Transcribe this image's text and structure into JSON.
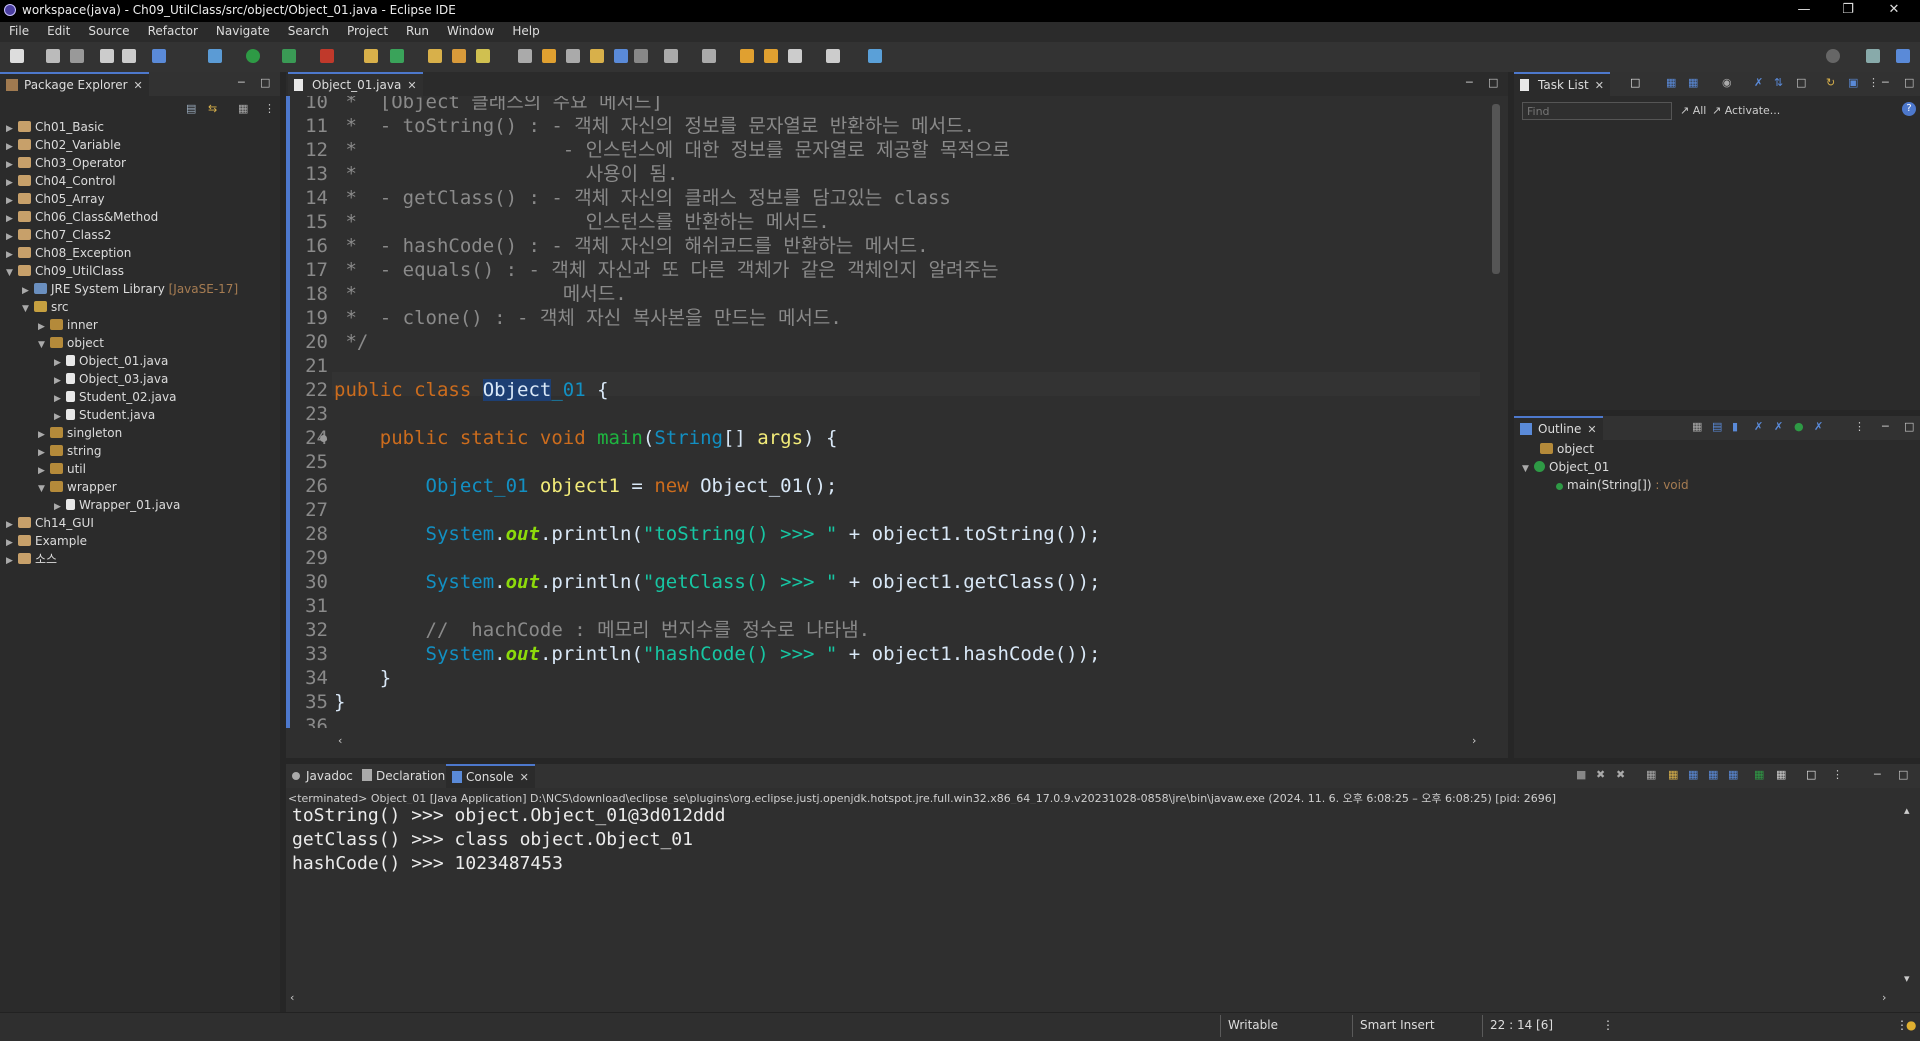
{
  "window": {
    "title": "workspace(java) - Ch09_UtilClass/src/object/Object_01.java - Eclipse IDE"
  },
  "menu": [
    "File",
    "Edit",
    "Source",
    "Refactor",
    "Navigate",
    "Search",
    "Project",
    "Run",
    "Window",
    "Help"
  ],
  "package_explorer": {
    "tab_label": "Package Explorer",
    "items": [
      {
        "label": "Ch01_Basic"
      },
      {
        "label": "Ch02_Variable"
      },
      {
        "label": "Ch03_Operator"
      },
      {
        "label": "Ch04_Control"
      },
      {
        "label": "Ch05_Array"
      },
      {
        "label": "Ch06_Class&Method"
      },
      {
        "label": "Ch07_Class2"
      },
      {
        "label": "Ch08_Exception"
      },
      {
        "label": "Ch09_UtilClass"
      },
      {
        "label": "JRE System Library",
        "deco": "[JavaSE-17]"
      },
      {
        "label": "src"
      },
      {
        "label": "inner"
      },
      {
        "label": "object"
      },
      {
        "label": "Object_01.java"
      },
      {
        "label": "Object_03.java"
      },
      {
        "label": "Student_02.java"
      },
      {
        "label": "Student.java"
      },
      {
        "label": "singleton"
      },
      {
        "label": "string"
      },
      {
        "label": "util"
      },
      {
        "label": "wrapper"
      },
      {
        "label": "Wrapper_01.java"
      },
      {
        "label": "Ch14_GUI"
      },
      {
        "label": "Example"
      },
      {
        "label": "소스"
      }
    ]
  },
  "editor": {
    "tab_label": "Object_01.java",
    "lines": [
      {
        "n": "10",
        "html": "<span class='cm'> *  [Object 클래스의 주요 메서드]</span>"
      },
      {
        "n": "11",
        "html": "<span class='cm'> *  - toString() : - 객체 자신의 정보를 문자열로 반환하는 메서드.</span>"
      },
      {
        "n": "12",
        "html": "<span class='cm'> *                  - 인스턴스에 대한 정보를 문자열로 제공할 목적으로</span>"
      },
      {
        "n": "13",
        "html": "<span class='cm'> *                    사용이 됨.</span>"
      },
      {
        "n": "14",
        "html": "<span class='cm'> *  - getClass() : - 객체 자신의 클래스 정보를 담고있는 class</span>"
      },
      {
        "n": "15",
        "html": "<span class='cm'> *                    인스턴스를 반환하는 메서드.</span>"
      },
      {
        "n": "16",
        "html": "<span class='cm'> *  - hashCode() : - 객체 자신의 해쉬코드를 반환하는 메서드.</span>"
      },
      {
        "n": "17",
        "html": "<span class='cm'> *  - equals() : - 객체 자신과 또 다른 객체가 같은 객체인지 알려주는</span>"
      },
      {
        "n": "18",
        "html": "<span class='cm'> *                  메서드.</span>"
      },
      {
        "n": "19",
        "html": "<span class='cm'> *  - clone() : - 객체 자신 복사본을 만드는 메서드.</span>"
      },
      {
        "n": "20",
        "html": "<span class='cm'> */</span>"
      },
      {
        "n": "21",
        "html": ""
      },
      {
        "n": "22",
        "html": "<span class='kw'>public class </span><span class='sel def'>Object</span><span class='ty'>_01</span><span class='def'> {</span>"
      },
      {
        "n": "23",
        "html": ""
      },
      {
        "n": "24",
        "html": "<span class='kw'>    public static void </span><span class='fn'>main</span><span class='def'>(</span><span class='ty'>String</span><span class='def'>[] </span><span class='var'>args</span><span class='def'>) {</span>"
      },
      {
        "n": "25",
        "html": ""
      },
      {
        "n": "26",
        "html": "<span class='ty'>        Object_01 </span><span class='var'>object1</span><span class='def'> = </span><span class='kw'>new </span><span class='def'>Object_01();</span>"
      },
      {
        "n": "27",
        "html": ""
      },
      {
        "n": "28",
        "html": "<span class='ty'>        System</span><span class='def'>.</span><span class='fld'>out</span><span class='def'>.println(</span><span class='st'>\"toString() &gt;&gt;&gt; \"</span><span class='def'> + object1.toString());</span>"
      },
      {
        "n": "29",
        "html": ""
      },
      {
        "n": "30",
        "html": "<span class='ty'>        System</span><span class='def'>.</span><span class='fld'>out</span><span class='def'>.println(</span><span class='st'>\"getClass() &gt;&gt;&gt; \"</span><span class='def'> + object1.getClass());</span>"
      },
      {
        "n": "31",
        "html": ""
      },
      {
        "n": "32",
        "html": "<span class='cm'>        //  hachCode : 메모리 번지수를 정수로 나타냄.</span>"
      },
      {
        "n": "33",
        "html": "<span class='ty'>        System</span><span class='def'>.</span><span class='fld'>out</span><span class='def'>.println(</span><span class='st'>\"hashCode() &gt;&gt;&gt; \"</span><span class='def'> + object1.hashCode());</span>"
      },
      {
        "n": "34",
        "html": "<span class='def'>    }</span>"
      },
      {
        "n": "35",
        "html": "<span class='def'>}</span>"
      },
      {
        "n": "36",
        "html": ""
      }
    ]
  },
  "task_list": {
    "tab_label": "Task List",
    "find_placeholder": "Find",
    "all_label": "All",
    "activate_label": "Activate..."
  },
  "outline": {
    "tab_label": "Outline",
    "package": "object",
    "class": "Object_01",
    "method": "main(String[])",
    "method_type": " : void"
  },
  "bottom_tabs": {
    "javadoc": "Javadoc",
    "declaration": "Declaration",
    "console": "Console"
  },
  "console": {
    "header": "<terminated> Object_01 [Java Application] D:\\NCS\\download\\eclipse_se\\plugins\\org.eclipse.justj.openjdk.hotspot.jre.full.win32.x86_64_17.0.9.v20231028-0858\\jre\\bin\\javaw.exe  (2024. 11. 6. 오후 6:08:25 – 오후 6:08:25) [pid: 2696]",
    "lines": [
      "toString() >>> object.Object_01@3d012ddd",
      "getClass() >>> class object.Object_01",
      "hashCode() >>> 1023487453"
    ]
  },
  "status": {
    "writable": "Writable",
    "insert": "Smart Insert",
    "position": "22 : 14 [6]"
  }
}
